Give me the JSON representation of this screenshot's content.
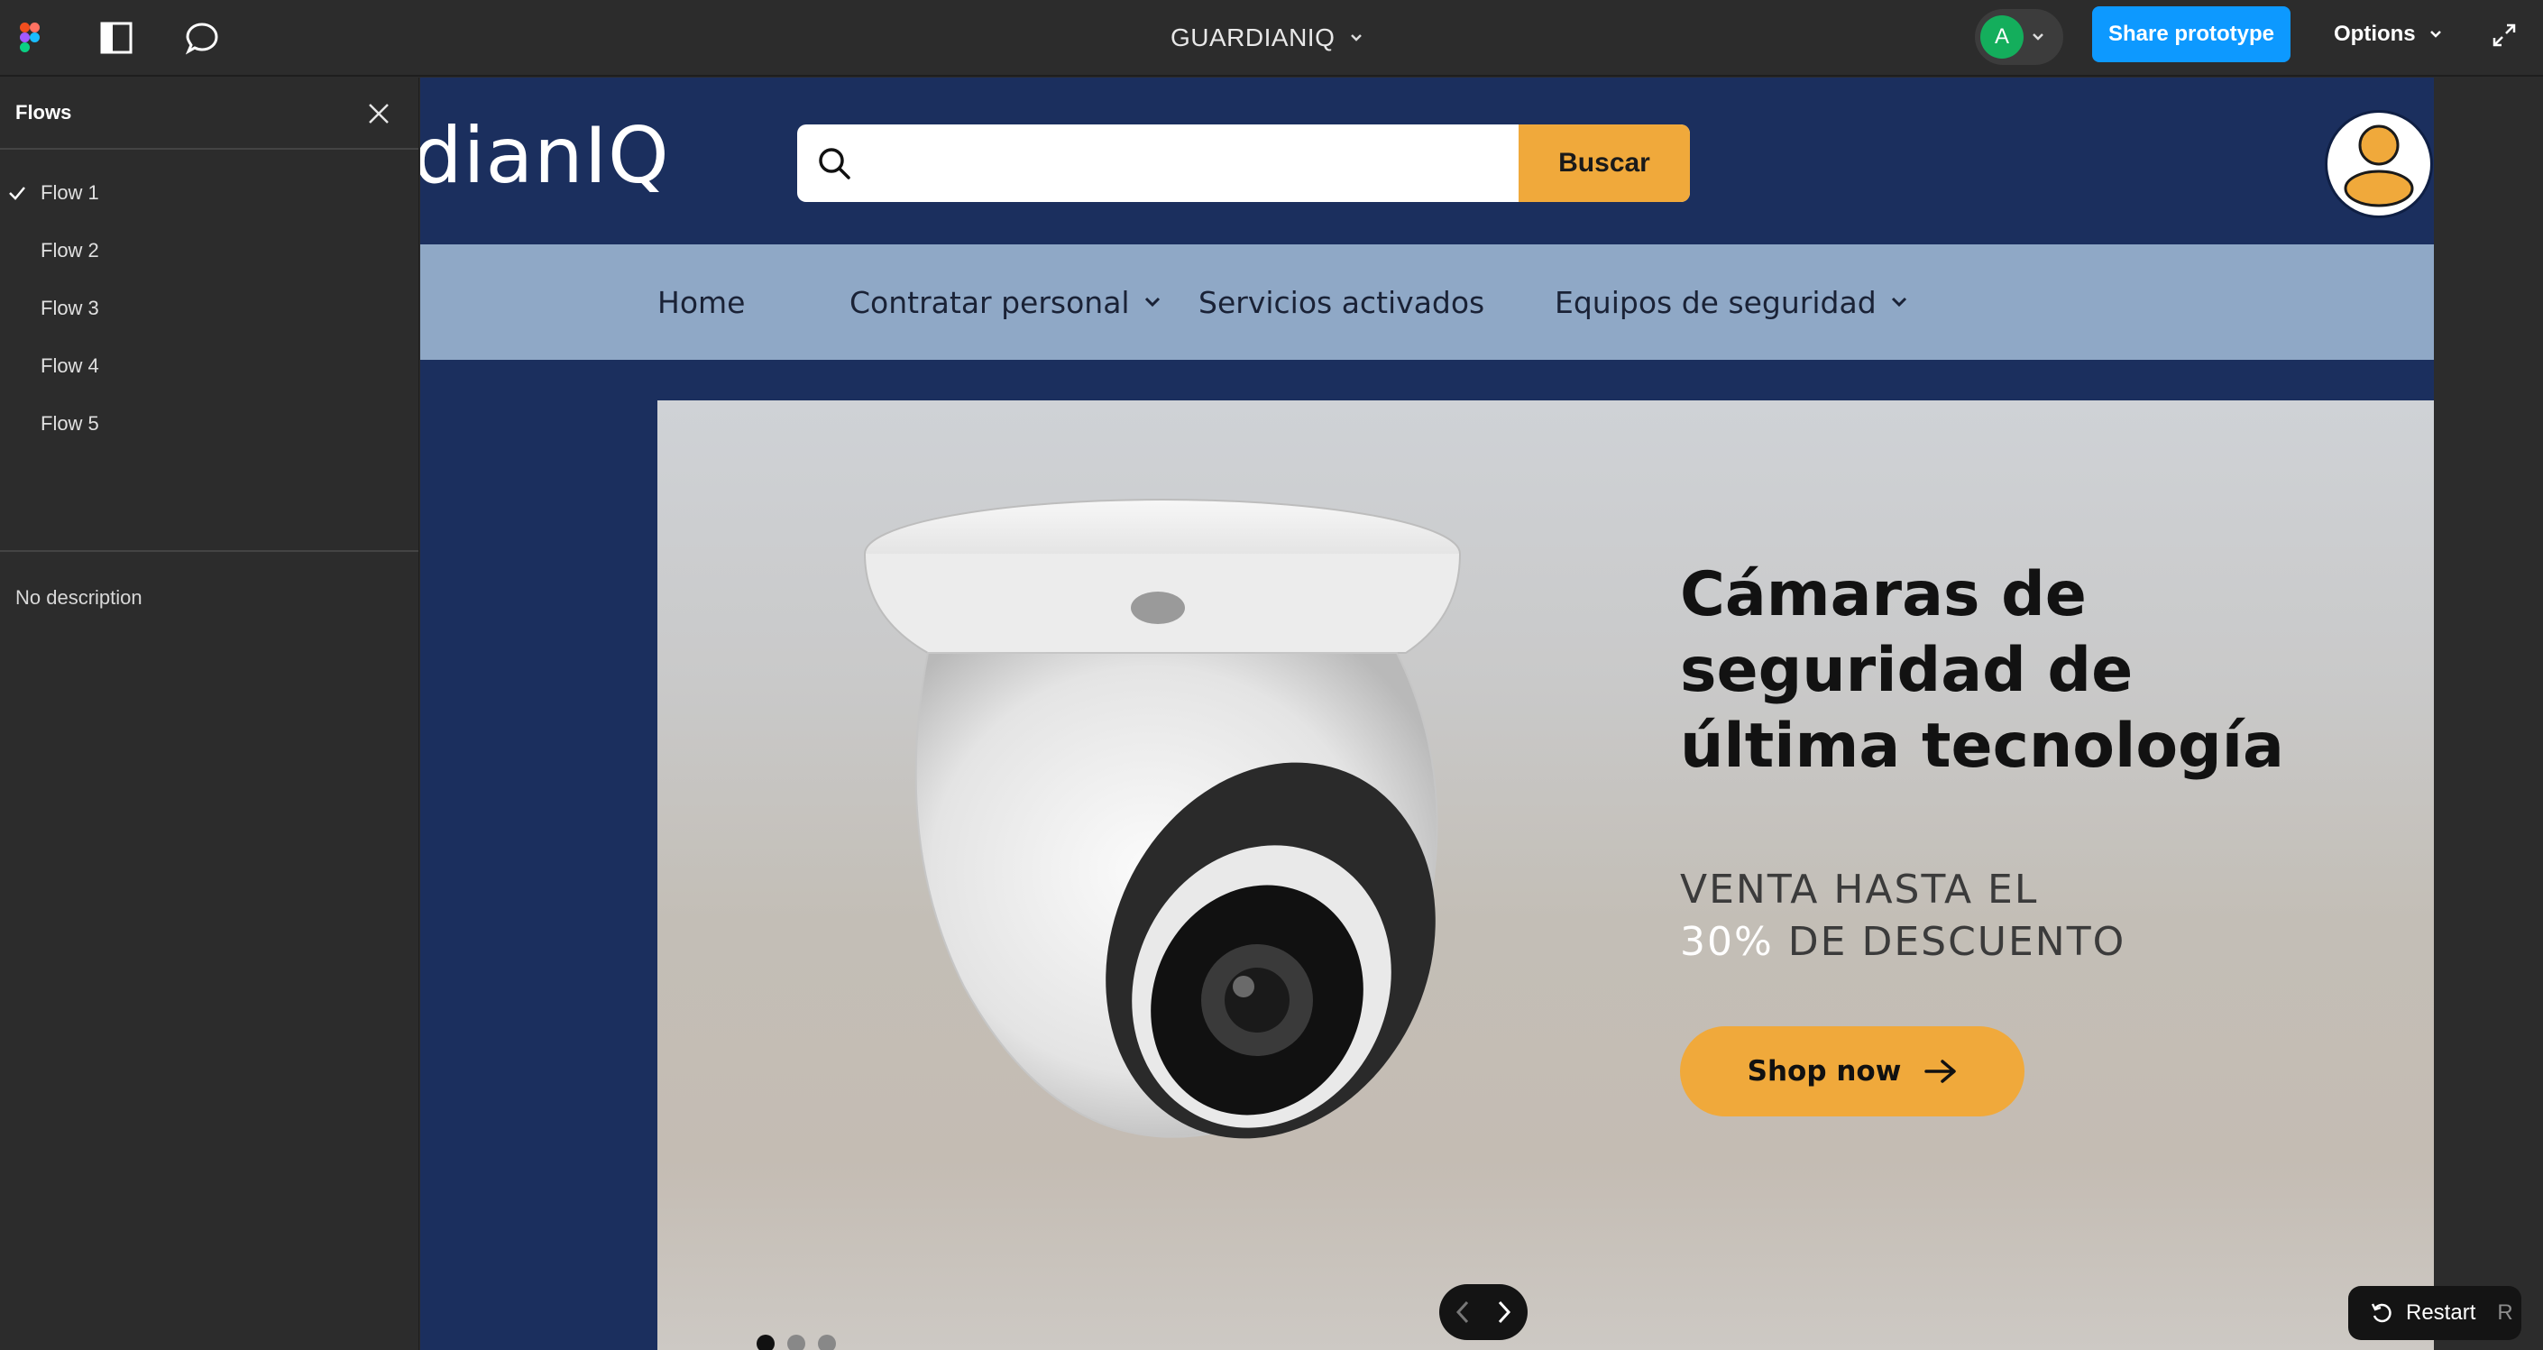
{
  "topbar": {
    "file_title": "GUARDIANIQ",
    "avatar_initial": "A",
    "share_label": "Share prototype",
    "options_label": "Options"
  },
  "sidebar": {
    "title": "Flows",
    "flows": [
      {
        "label": "Flow 1",
        "selected": true
      },
      {
        "label": "Flow 2",
        "selected": false
      },
      {
        "label": "Flow 3",
        "selected": false
      },
      {
        "label": "Flow 4",
        "selected": false
      },
      {
        "label": "Flow 5",
        "selected": false
      }
    ],
    "description": "No description"
  },
  "site": {
    "logo_text": "dianIQ",
    "search": {
      "placeholder": "",
      "value": "",
      "button_label": "Buscar"
    },
    "nav": [
      {
        "label": "Home",
        "has_dropdown": false
      },
      {
        "label": "Contratar personal",
        "has_dropdown": true
      },
      {
        "label": "Servicios activados",
        "has_dropdown": false
      },
      {
        "label": "Equipos de seguridad",
        "has_dropdown": true
      }
    ],
    "hero": {
      "headline_lines": [
        "Cámaras de",
        "seguridad de",
        "última tecnología"
      ],
      "sub_line1": "VENTA HASTA EL",
      "sub_pct": "30%",
      "sub_rest": "DE DESCUENTO",
      "cta_label": "Shop now"
    },
    "carousel": {
      "slides": 3,
      "active_slide": 1
    }
  },
  "restart": {
    "label": "Restart",
    "shortcut": "R"
  },
  "colors": {
    "site_bg": "#1b2f5e",
    "nav_bg": "#8fa8c6",
    "accent": "#f0a93b",
    "share_blue": "#0d99ff",
    "avatar_green": "#14ae5c"
  }
}
